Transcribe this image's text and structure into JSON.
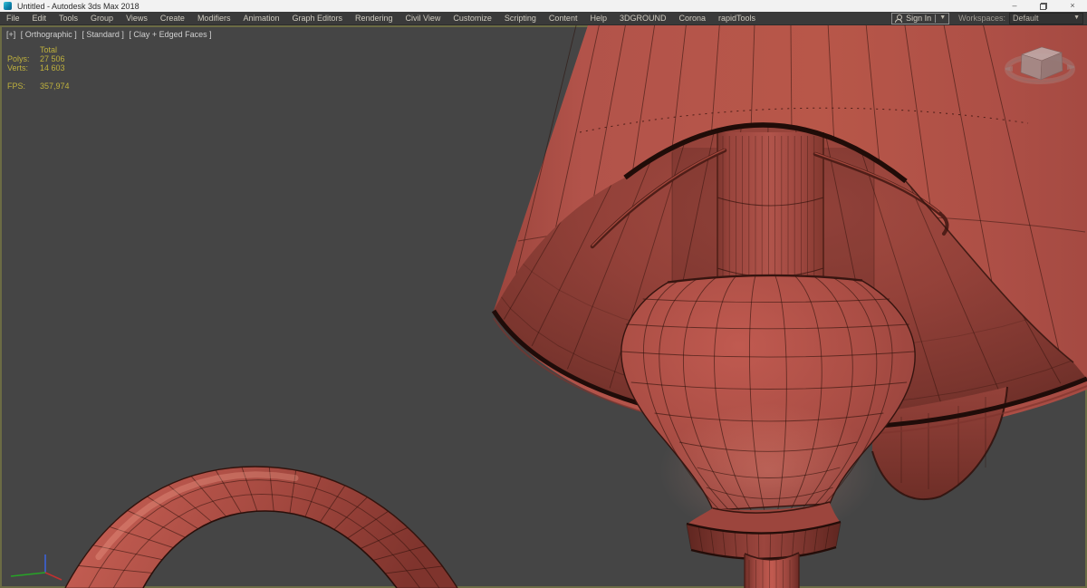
{
  "window": {
    "title": "Untitled - Autodesk 3ds Max 2018",
    "controls": {
      "minimize": "–",
      "close": "×"
    }
  },
  "menu": {
    "items": [
      "File",
      "Edit",
      "Tools",
      "Group",
      "Views",
      "Create",
      "Modifiers",
      "Animation",
      "Graph Editors",
      "Rendering",
      "Civil View",
      "Customize",
      "Scripting",
      "Content",
      "Help",
      "3DGROUND",
      "Corona",
      "rapidTools"
    ]
  },
  "account": {
    "sign_in_label": "Sign In"
  },
  "workspaces": {
    "label": "Workspaces:",
    "selected": "Default"
  },
  "viewport": {
    "label_segments": {
      "pov": "[+]",
      "view": "[ Orthographic ]",
      "standard": "[ Standard ]",
      "shading": "[ Clay + Edged Faces ]"
    },
    "statistics": {
      "total_header": "Total",
      "polys_label": "Polys:",
      "polys_value": "27 506",
      "verts_label": "Verts:",
      "verts_value": "14 603",
      "fps_label": "FPS:",
      "fps_value": "357,974"
    }
  },
  "colors": {
    "viewport_background": "#454545",
    "viewport_border": "#6b6b44",
    "clay_base": "#b2534a",
    "clay_inner_shadow": "#6f2f29",
    "wireframe": "#2e120d",
    "stats_text": "#bfb13d",
    "menubar_background": "#3a3a3a",
    "titlebar_background": "#f2f2f2"
  }
}
